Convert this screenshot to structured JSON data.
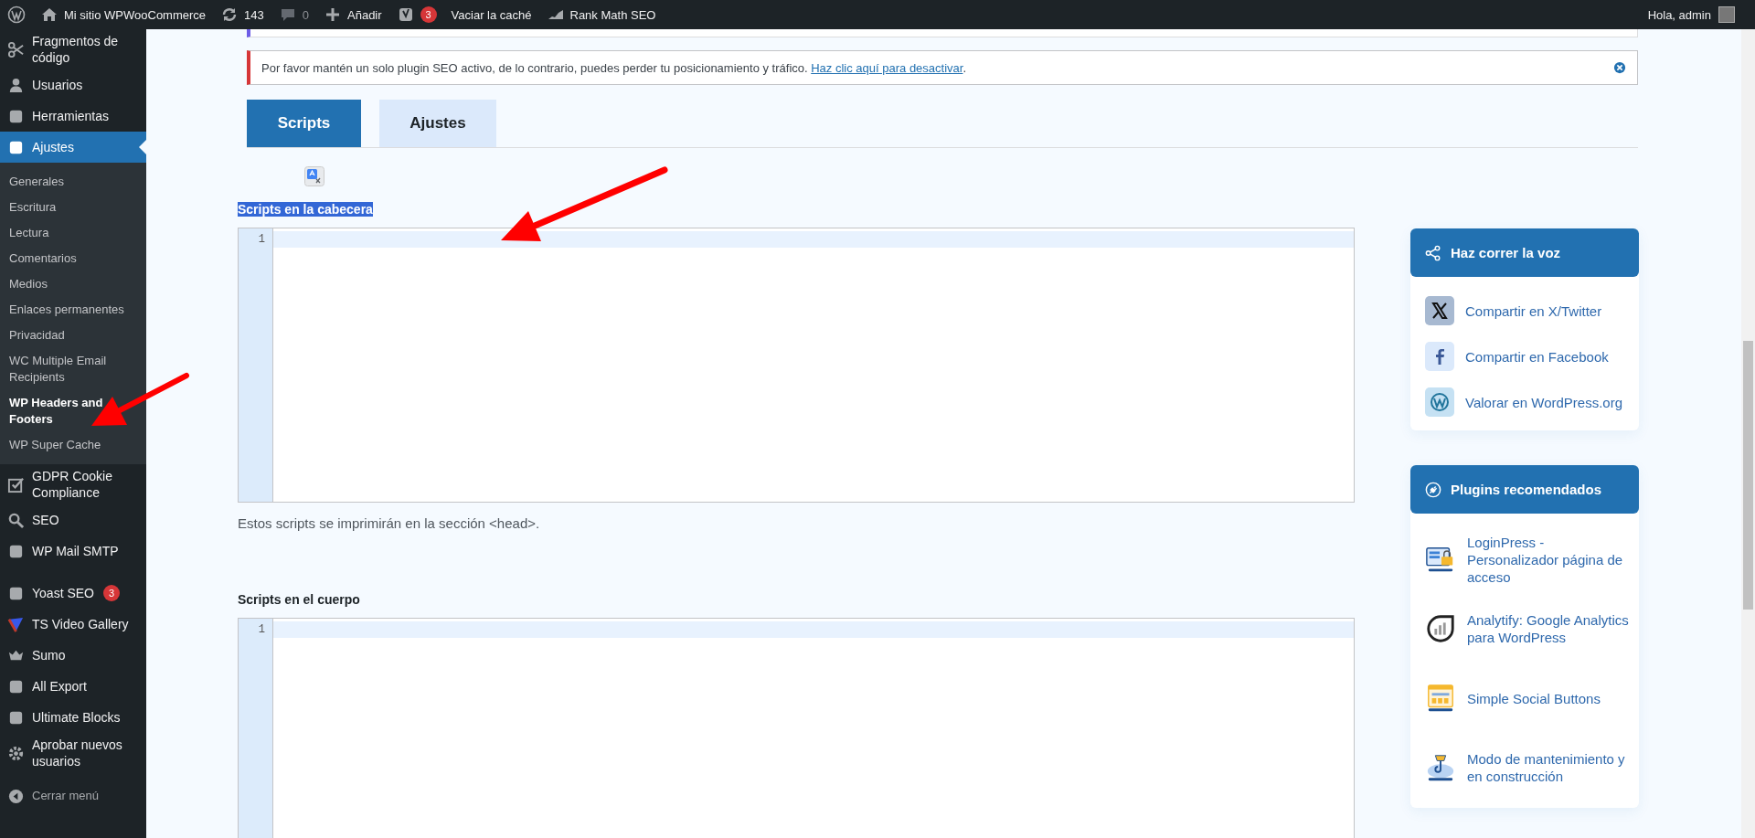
{
  "admin_bar": {
    "site_name": "Mi sitio WPWooCommerce",
    "updates": "143",
    "comments": "0",
    "new": "Añadir",
    "yoast_badge": "3",
    "cache": "Vaciar la caché",
    "rank_math": "Rank Math SEO",
    "greeting": "Hola, admin"
  },
  "sidebar": {
    "items": [
      {
        "label": "Fragmentos de código",
        "selected": false
      },
      {
        "label": "Usuarios",
        "selected": false
      },
      {
        "label": "Herramientas",
        "selected": false
      },
      {
        "label": "Ajustes",
        "selected": true,
        "children": [
          {
            "label": "Generales",
            "selected": false
          },
          {
            "label": "Escritura",
            "selected": false
          },
          {
            "label": "Lectura",
            "selected": false
          },
          {
            "label": "Comentarios",
            "selected": false
          },
          {
            "label": "Medios",
            "selected": false
          },
          {
            "label": "Enlaces permanentes",
            "selected": false
          },
          {
            "label": "Privacidad",
            "selected": false
          },
          {
            "label": "WC Multiple Email Recipients",
            "selected": false
          },
          {
            "label": "WP Headers and Footers",
            "selected": true
          },
          {
            "label": "WP Super Cache",
            "selected": false
          }
        ]
      },
      {
        "label": "GDPR Cookie Compliance",
        "selected": false
      },
      {
        "label": "SEO",
        "selected": false
      },
      {
        "label": "WP Mail SMTP",
        "selected": false
      },
      {
        "label": "Yoast SEO",
        "selected": false,
        "badge": "3",
        "gap_before": true
      },
      {
        "label": "TS Video Gallery",
        "selected": false
      },
      {
        "label": "Sumo",
        "selected": false
      },
      {
        "label": "All Export",
        "selected": false
      },
      {
        "label": "Ultimate Blocks",
        "selected": false
      },
      {
        "label": "Aprobar nuevos usuarios",
        "selected": false
      }
    ],
    "collapse": "Cerrar menú"
  },
  "notice": {
    "text": "Por favor mantén un solo plugin SEO activo, de lo contrario, puedes perder tu posicionamiento y tráfico.",
    "link": "Haz clic aquí para desactivar",
    "end": "."
  },
  "tabs": [
    {
      "label": "Scripts",
      "selected": true
    },
    {
      "label": "Ajustes",
      "selected": false
    }
  ],
  "sections": [
    {
      "label": "Scripts en la cabecera",
      "highlighted": true,
      "line_numbers": [
        "1"
      ],
      "help": "Estos scripts se imprimirán en la sección <head>."
    },
    {
      "label": "Scripts en el cuerpo",
      "highlighted": false,
      "line_numbers": [
        "1"
      ]
    }
  ],
  "widgets": [
    {
      "title": "Haz correr la voz",
      "kind": "share",
      "items": [
        {
          "label": "Compartir en X/Twitter"
        },
        {
          "label": "Compartir en Facebook"
        },
        {
          "label": "Valorar en WordPress.org"
        }
      ]
    },
    {
      "title": "Plugins recomendados",
      "kind": "plugins",
      "items": [
        {
          "label": "LoginPress - Personalizador página de acceso"
        },
        {
          "label": "Analytify: Google Analytics para WordPress"
        },
        {
          "label": "Simple Social Buttons"
        },
        {
          "label": "Modo de mantenimiento y en construcción"
        }
      ]
    }
  ]
}
